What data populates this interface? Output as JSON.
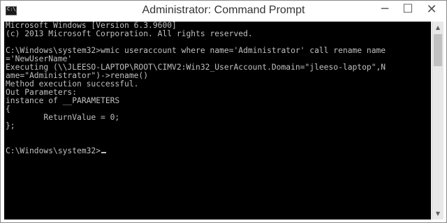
{
  "window": {
    "title": "Administrator: Command Prompt",
    "minimize_glyph": "─",
    "maximize_glyph": "☐",
    "close_glyph": "✕",
    "icon": "cmd-app-icon"
  },
  "console": {
    "lines": [
      "Microsoft Windows [Version 6.3.9600]",
      "(c) 2013 Microsoft Corporation. All rights reserved.",
      "",
      "C:\\Windows\\system32>wmic useraccount where name='Administrator' call rename name",
      "='NewUserName'",
      "Executing (\\\\JLEESO-LAPTOP\\ROOT\\CIMV2:Win32_UserAccount.Domain=\"jleeso-laptop\",N",
      "ame=\"Administrator\")->rename()",
      "Method execution successful.",
      "Out Parameters:",
      "instance of __PARAMETERS",
      "{",
      "        ReturnValue = 0;",
      "};",
      "",
      "",
      "C:\\Windows\\system32>"
    ]
  },
  "scrollbar": {
    "up_glyph": "▲",
    "down_glyph": "▼"
  },
  "colors": {
    "console_bg": "#000000",
    "console_text": "#c0c0c0",
    "titlebar_bg": "#ffffff"
  }
}
